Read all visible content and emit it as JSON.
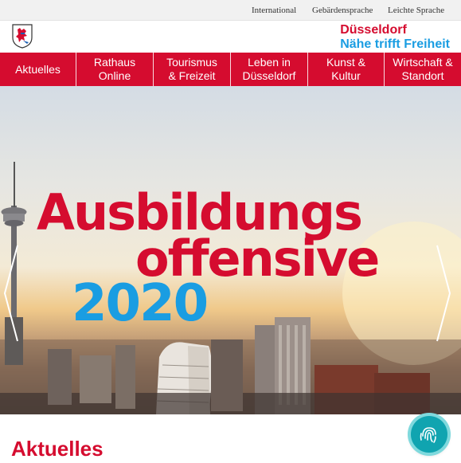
{
  "utility": {
    "links": [
      "International",
      "Gebärdensprache",
      "Leichte Sprache"
    ]
  },
  "header": {
    "city": "Düsseldorf",
    "tagline": "Nähe trifft Freiheit"
  },
  "nav": {
    "items": [
      {
        "label": "Aktuelles"
      },
      {
        "label": "Rathaus Online"
      },
      {
        "label": "Tourismus & Freizeit"
      },
      {
        "label": "Leben in Düsseldorf"
      },
      {
        "label": "Kunst & Kultur"
      },
      {
        "label": "Wirtschaft & Standort"
      }
    ]
  },
  "hero": {
    "line1": "Ausbildungs",
    "line2": "offensive",
    "year": "2020"
  },
  "section": {
    "heading": "Aktuelles"
  },
  "colors": {
    "brand_red": "#d50c2f",
    "brand_blue": "#1a9de2"
  }
}
